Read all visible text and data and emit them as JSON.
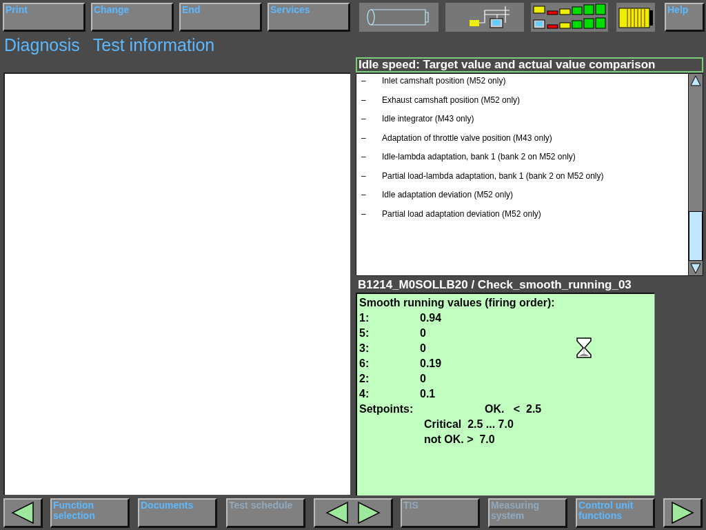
{
  "top_buttons": [
    {
      "label": "Print",
      "disabled": false
    },
    {
      "label": "Change",
      "disabled": false
    },
    {
      "label": "End",
      "disabled": false
    },
    {
      "label": "Services",
      "disabled": false
    }
  ],
  "help_button": {
    "label": "Help",
    "disabled": false
  },
  "breadcrumb": [
    "Diagnosis",
    "Test information"
  ],
  "test_info": {
    "title": "Idle speed: Target value and actual value comparison",
    "items": [
      {
        "bullet": "–",
        "text": "Inlet camshaft position (M52 only)"
      },
      {
        "bullet": "–",
        "text": "Exhaust camshaft position (M52 only)"
      },
      {
        "bullet": "–",
        "text": "Idle integrator (M43 only)"
      },
      {
        "bullet": "–",
        "text": "Adaptation of throttle valve position (M43 only)"
      },
      {
        "bullet": "–",
        "text": "Idle-lambda adaptation, bank 1 (bank 2 on M52 only)"
      },
      {
        "bullet": "–",
        "text": "Partial load-lambda adaptation, bank 1 (bank 2 on M52 only)"
      },
      {
        "bullet": "–",
        "text": "Idle adaptation deviation (M52 only)"
      },
      {
        "bullet": "–",
        "text": "Partial load adaptation deviation (M52 only)"
      }
    ]
  },
  "result": {
    "title": "B1214_M0SOLLB20 / Check_smooth_running_03",
    "heading": "Smooth running values (firing order):",
    "readings": [
      {
        "cylinder": "1:",
        "value": "0.94"
      },
      {
        "cylinder": "5:",
        "value": "0"
      },
      {
        "cylinder": "3:",
        "value": "0"
      },
      {
        "cylinder": "6:",
        "value": "0.19"
      },
      {
        "cylinder": "2:",
        "value": "0"
      },
      {
        "cylinder": "4:",
        "value": "0.1"
      }
    ],
    "setpoints_label": "Setpoints:",
    "setpoints": [
      "OK.   <  2.5",
      "Critical  2.5 ... 7.0",
      "not OK. >  7.0"
    ]
  },
  "bottom_nav": [
    {
      "kind": "back"
    },
    {
      "kind": "text",
      "label": "Function selection",
      "disabled": false
    },
    {
      "kind": "text",
      "label": "Documents",
      "disabled": false
    },
    {
      "kind": "text",
      "label": "Test schedule",
      "disabled": true
    },
    {
      "kind": "step"
    },
    {
      "kind": "text",
      "label": "TIS",
      "disabled": true
    },
    {
      "kind": "text",
      "label": "Measuring system",
      "disabled": true
    },
    {
      "kind": "text",
      "label": "Control unit functions",
      "disabled": false
    },
    {
      "kind": "forward"
    }
  ]
}
